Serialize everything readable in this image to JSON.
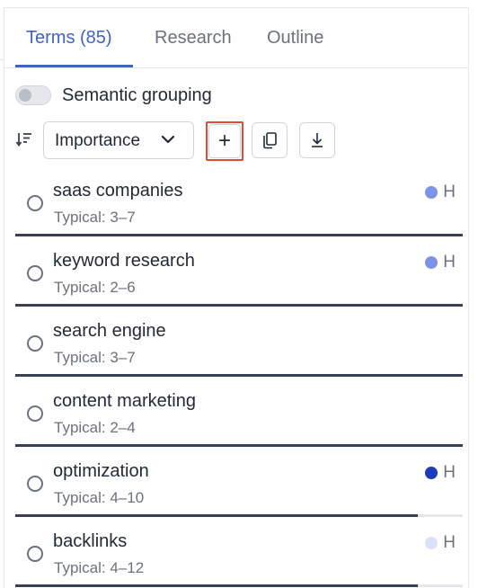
{
  "tabs": [
    {
      "label": "Terms (85)",
      "active": true
    },
    {
      "label": "Research",
      "active": false
    },
    {
      "label": "Outline",
      "active": false
    }
  ],
  "semantic_grouping": {
    "label": "Semantic grouping",
    "enabled": false
  },
  "toolbar": {
    "sort_select": "Importance",
    "add_button": "+",
    "copy_icon": "copy-icon",
    "download_icon": "download-icon"
  },
  "terms": [
    {
      "name": "saas companies",
      "typical": "Typical: 3–7",
      "badge": "H",
      "dot_color": "#7d93e8",
      "progress": 1.0
    },
    {
      "name": "keyword research",
      "typical": "Typical: 2–6",
      "badge": "H",
      "dot_color": "#7d93e8",
      "progress": 1.0
    },
    {
      "name": "search engine",
      "typical": "Typical: 3–7",
      "badge": "",
      "dot_color": "",
      "progress": 1.0
    },
    {
      "name": "content marketing",
      "typical": "Typical: 2–4",
      "badge": "",
      "dot_color": "",
      "progress": 1.0
    },
    {
      "name": "optimization",
      "typical": "Typical: 4–10",
      "badge": "H",
      "dot_color": "#1d3bb8",
      "progress": 0.9
    },
    {
      "name": "backlinks",
      "typical": "Typical: 4–12",
      "badge": "H",
      "dot_color": "#dbe2f8",
      "progress": 0.9
    }
  ],
  "colors": {
    "accent": "#3f63c6",
    "highlight_border": "#e04a2f"
  }
}
